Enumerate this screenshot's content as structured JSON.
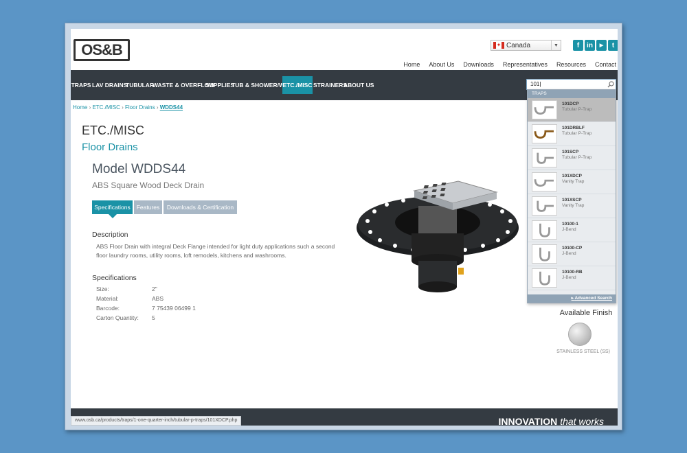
{
  "header": {
    "logo_text": "OS&B",
    "country": "Canada",
    "social": [
      {
        "icon": "facebook-icon",
        "glyph": "f"
      },
      {
        "icon": "linkedin-icon",
        "glyph": "in"
      },
      {
        "icon": "youtube-icon",
        "glyph": "▶"
      },
      {
        "icon": "twitter-icon",
        "glyph": "t"
      }
    ],
    "top_links": [
      "Home",
      "About Us",
      "Downloads",
      "Representatives",
      "Resources",
      "Contact"
    ]
  },
  "nav": {
    "items": [
      "TRAPS",
      "LAV DRAINS",
      "TUBULAR",
      "WASTE & OVERFLOW",
      "SUPPLIES",
      "TUB & SHOWER/WC",
      "ETC./MISC",
      "STRAINERS",
      "ABOUT US"
    ],
    "active": "ETC./MISC"
  },
  "search": {
    "value": "101"
  },
  "breadcrumb": {
    "items": [
      "Home",
      "ETC./MISC",
      "Floor Drains"
    ],
    "current": "WDDS44"
  },
  "product": {
    "category": "ETC./MISC",
    "subcategory": "Floor Drains",
    "model": "Model WDDS44",
    "name": "ABS Square Wood Deck Drain",
    "tabs": [
      "Specifications",
      "Features",
      "Downloads & Certification"
    ],
    "description_heading": "Description",
    "description": "ABS Floor Drain with integral Deck Flange intended for light duty applications such a second floor laundry rooms, utility rooms, loft remodels, kitchens and washrooms.",
    "specs_heading": "Specifications",
    "specs": [
      {
        "label": "Size:",
        "value": "2\""
      },
      {
        "label": "Material:",
        "value": "ABS"
      },
      {
        "label": "Barcode:",
        "value": "7 75439 06499 1"
      },
      {
        "label": "Carton Quantity:",
        "value": "5"
      }
    ],
    "finish_heading": "Available Finish",
    "finish_label": "STAINLESS STEEL (SS)"
  },
  "dropdown": {
    "category": "TRAPS",
    "items": [
      {
        "code": "101DCP",
        "type": "Tubular P-Trap"
      },
      {
        "code": "101DRBLF",
        "type": "Tubular P-Trap"
      },
      {
        "code": "101SCP",
        "type": "Tubular P-Trap"
      },
      {
        "code": "101XDCP",
        "type": "Vanity Trap"
      },
      {
        "code": "101XSCP",
        "type": "Vanity Trap"
      },
      {
        "code": "10100-1",
        "type": "J-Bend"
      },
      {
        "code": "10100-CP",
        "type": "J-Bend"
      },
      {
        "code": "10100-RB",
        "type": "J-Bend"
      }
    ],
    "advanced": "Advanced Search"
  },
  "footer": {
    "tagline_bold": "INNOVATION",
    "tagline_thin": "that works"
  },
  "status_bar": "www.osb.ca/products/traps/1-one-quarter-inch/tubular-p-traps/101XDCP.php"
}
